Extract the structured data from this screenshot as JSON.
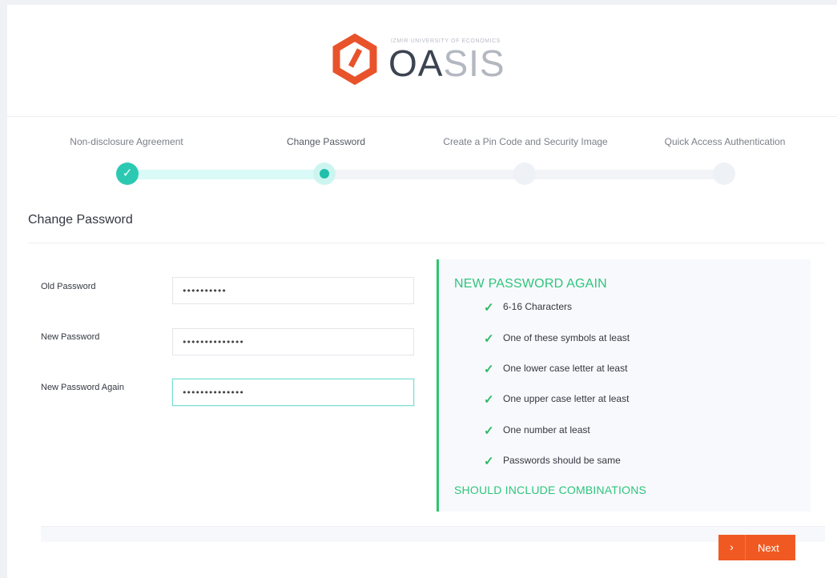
{
  "brand": {
    "university": "IZMIR UNIVERSITY OF ECONOMICS",
    "name_part1": "OA",
    "name_part2": "SIS",
    "logo_color": "#e8532b"
  },
  "stepper": {
    "steps": [
      {
        "label": "Non-disclosure Agreement",
        "state": "done"
      },
      {
        "label": "Change Password",
        "state": "current"
      },
      {
        "label": "Create a Pin Code and Security Image",
        "state": "pending"
      },
      {
        "label": "Quick Access Authentication",
        "state": "pending"
      }
    ],
    "done_mark": "✓"
  },
  "section": {
    "title": "Change Password"
  },
  "form": {
    "old_password": {
      "label": "Old Password",
      "value": "••••••••••"
    },
    "new_password": {
      "label": "New Password",
      "value": "••••••••••••••"
    },
    "new_password_again": {
      "label": "New Password Again",
      "value": "••••••••••••••"
    }
  },
  "rules": {
    "title": "NEW PASSWORD AGAIN",
    "items": [
      {
        "text": "6-16 Characters",
        "met": true
      },
      {
        "text": "One of these symbols at least",
        "met": true
      },
      {
        "text": "One lower case letter at least",
        "met": true
      },
      {
        "text": "One upper case letter at least",
        "met": true
      },
      {
        "text": "One number at least",
        "met": true
      },
      {
        "text": "Passwords should be same",
        "met": true
      }
    ],
    "check_glyph": "✓",
    "footer": "SHOULD INCLUDE COMBINATIONS",
    "accent_color": "#2dc57d"
  },
  "actions": {
    "next_label": "Next",
    "next_icon": "›",
    "next_color": "#f05a22"
  }
}
